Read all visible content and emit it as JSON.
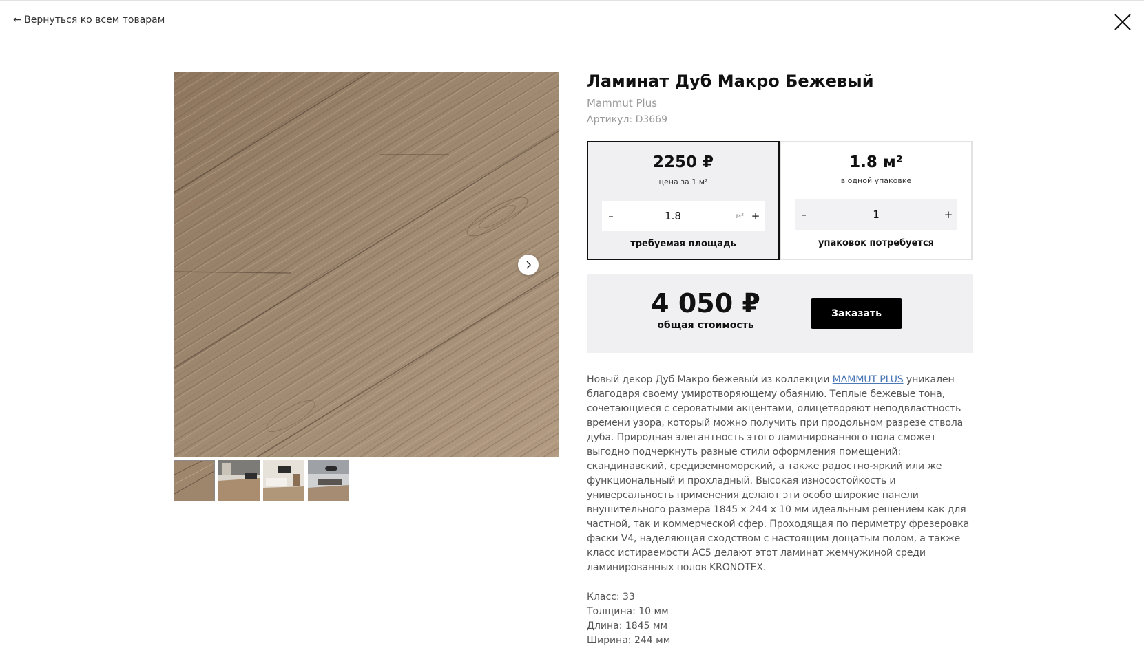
{
  "nav": {
    "back_label": "← Вернуться ко всем товарам"
  },
  "product": {
    "title": "Ламинат Дуб Макро Бежевый",
    "brand": "Mammut Plus",
    "sku": "Артикул: D3669"
  },
  "gallery": {
    "thumbnail_count": 4,
    "active_index": 0
  },
  "calc": {
    "price": {
      "value": "2250 ₽",
      "caption": "цена за 1 м²"
    },
    "area": {
      "value": "1.8",
      "unit": "м²",
      "minus": "–",
      "plus": "+",
      "label": "требуемая площадь"
    },
    "pack": {
      "value": "1.8 м²",
      "caption": "в одной упаковке"
    },
    "packs": {
      "value": "1",
      "minus": "–",
      "plus": "+",
      "label": "упаковок потребуется"
    }
  },
  "total": {
    "value": "4 050 ₽",
    "caption": "общая стоимость",
    "order_label": "Заказать"
  },
  "description": {
    "part1": "Новый декор Дуб Макро бежевый из коллекции ",
    "link": "MAMMUT PLUS",
    "part2": " уникален благодаря своему умиротворяющему обаянию. Теплые бежевые тона, сочетающиеся с сероватыми акцентами, олицетворяют неподвластность времени узора, который можно получить при продольном разрезе ствола дуба. Природная элегантность этого ламинированного пола сможет выгодно подчеркнуть разные стили оформления помещений: скандинавский, средиземноморский, а также радостно-яркий или же функциональный и прохладный. Высокая износостойкость и универсальность применения делают эти особо широкие панели внушительного размера 1845 x 244 x 10 мм идеальным решением как для частной, так и коммерческой сфер. Проходящая по периметру фрезеровка фаски V4, наделяющая сходством с настоящим дощатым полом, а также класс истираемости AC5 делают этот ламинат жемчужиной среди ламинированных полов KRONOTEX."
  },
  "specs": [
    "Класс: 33",
    "Толщина: 10 мм",
    "Длина: 1845 мм",
    "Ширина: 244 мм"
  ],
  "colors": {
    "wood": "#9b836b",
    "link": "#4a77b5",
    "panel": "#f0f0f2",
    "button": "#000000"
  }
}
